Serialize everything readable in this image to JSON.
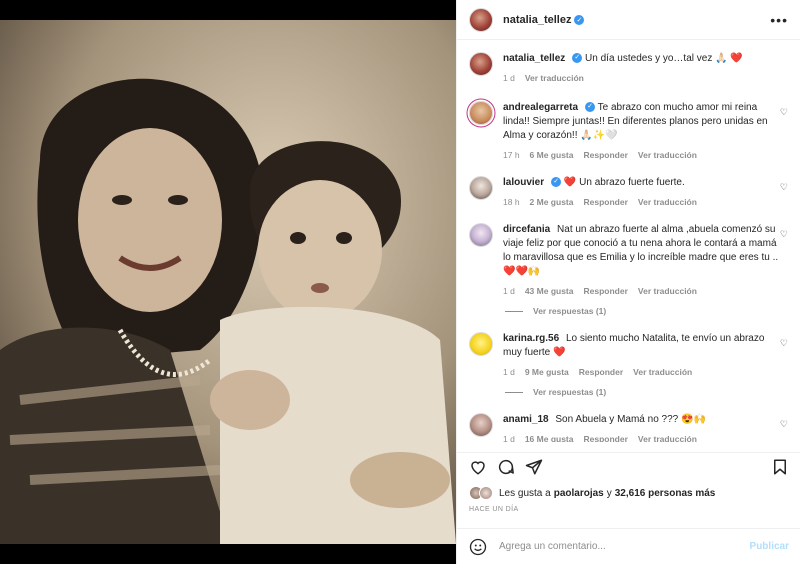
{
  "header": {
    "username": "natalia_tellez"
  },
  "caption": {
    "user": "natalia_tellez",
    "text": "Un día ustedes y yo…tal vez 🙏🏻 ❤️",
    "time": "1 d",
    "translate": "Ver traducción"
  },
  "comments": [
    {
      "user": "andrealegarreta",
      "verified": true,
      "text": "Te abrazo con mucho amor mi reina linda!! Siempre juntas!! En diferentes planos pero unidas en Alma y corazón!! 🙏🏻✨🤍",
      "time": "17 h",
      "likes": "6 Me gusta",
      "reply": "Responder",
      "translate": "Ver traducción"
    },
    {
      "user": "lalouvier",
      "verified": true,
      "text": "❤️ Un abrazo fuerte fuerte.",
      "time": "18 h",
      "likes": "2 Me gusta",
      "reply": "Responder",
      "translate": "Ver traducción"
    },
    {
      "user": "dircefania",
      "verified": false,
      "text": "Nat un abrazo fuerte al alma ,abuela comenzó su viaje feliz por que conoció a tu nena ahora le contará a mamá lo maravillosa que es Emilia y lo increíble madre que eres tu .. ❤️❤️🙌",
      "time": "1 d",
      "likes": "43 Me gusta",
      "reply": "Responder",
      "translate": "Ver traducción",
      "replies": "Ver respuestas (1)"
    },
    {
      "user": "karina.rg.56",
      "verified": false,
      "text": "Lo siento mucho Natalita, te envío un abrazo muy fuerte ❤️",
      "time": "1 d",
      "likes": "9 Me gusta",
      "reply": "Responder",
      "translate": "Ver traducción",
      "replies": "Ver respuestas (1)"
    },
    {
      "user": "anami_18",
      "verified": false,
      "text": "Son Abuela y Mamá no ??? 😍🙌",
      "time": "1 d",
      "likes": "16 Me gusta",
      "reply": "Responder",
      "translate": "Ver traducción"
    }
  ],
  "likes": {
    "prefix": "Les gusta a",
    "user": "paolarojas",
    "connector": "y",
    "count": "32,616 personas más"
  },
  "time_ago": "HACE UN DÍA",
  "add_comment": {
    "placeholder": "Agrega un comentario...",
    "publish": "Publicar"
  },
  "colors": {
    "link_blue": "#3897f0",
    "publish_disabled": "#b2dffc",
    "muted": "#8e8e8e",
    "text": "#262626"
  },
  "icons": [
    "more-icon",
    "verified-icon",
    "heart-icon",
    "comment-icon",
    "share-icon",
    "bookmark-icon",
    "emoji-icon"
  ]
}
